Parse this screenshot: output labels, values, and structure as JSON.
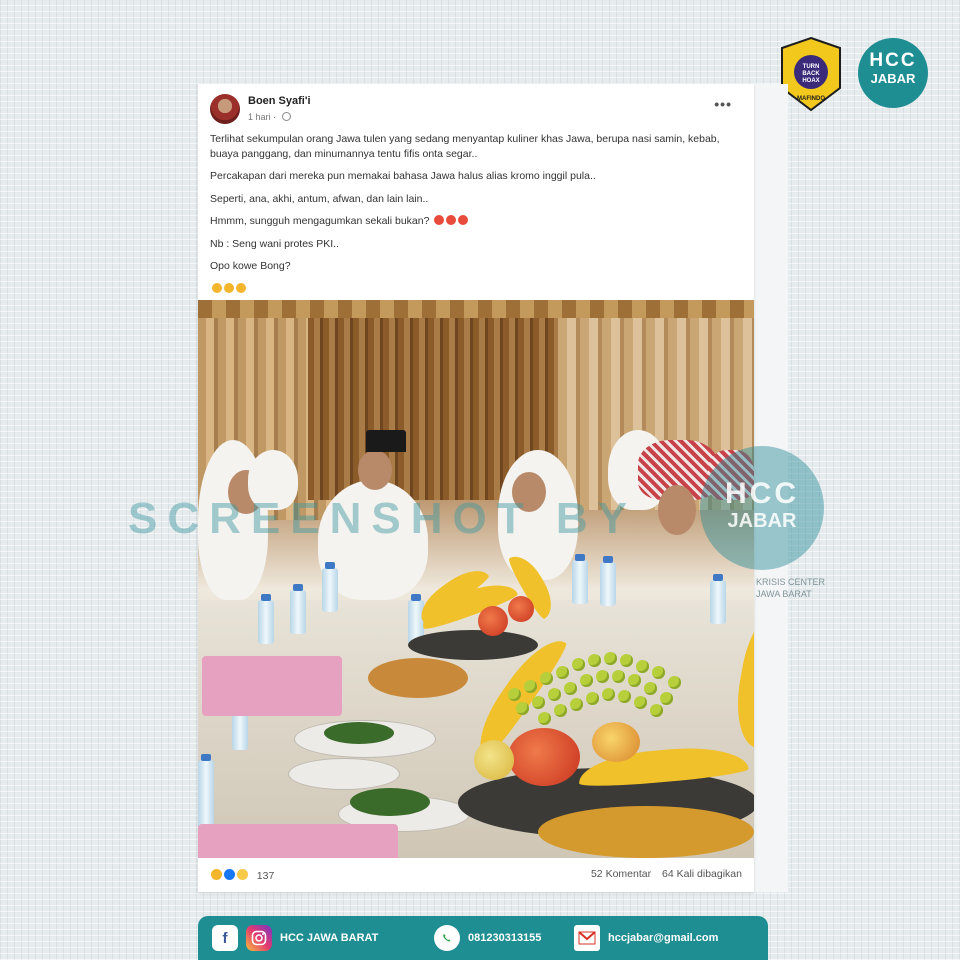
{
  "post": {
    "author": "Boen Syafi'i",
    "time": "1 hari",
    "paragraphs": [
      "Terlihat sekumpulan orang Jawa tulen yang sedang menyantap kuliner khas Jawa, berupa nasi samin, kebab, buaya panggang, dan minumannya tentu fifis onta segar..",
      "Percakapan dari mereka pun memakai bahasa Jawa halus alias kromo inggil pula..",
      "Seperti, ana, akhi, antum, afwan, dan lain lain..",
      "Hmmm, sungguh mengagumkan sekali bukan?",
      "Nb : Seng wani protes PKI..",
      "Opo kowe Bong?"
    ],
    "reaction_count": "137",
    "comments": "52 Komentar",
    "shares": "64 Kali dibagikan"
  },
  "watermark": {
    "text": "SCREENSHOT BY",
    "logo_top": "HCC",
    "logo_bottom": "JABAR",
    "sub_line1": "KRISIS CENTER",
    "sub_line2": "JAWA BARAT"
  },
  "logos": {
    "hcc_top": "HCC",
    "hcc_bottom": "JABAR",
    "mafindo_center": "TURN BACK HOAX",
    "mafindo_name": "MAFINDO"
  },
  "contact": {
    "facebook_icon": "f",
    "name": "HCC JAWA BARAT",
    "phone": "081230313155",
    "email": "hccjabar@gmail.com"
  },
  "colors": {
    "brand_teal": "#1f8e93",
    "card_bg": "#ffffff",
    "mafindo_yellow": "#f2c81c"
  }
}
